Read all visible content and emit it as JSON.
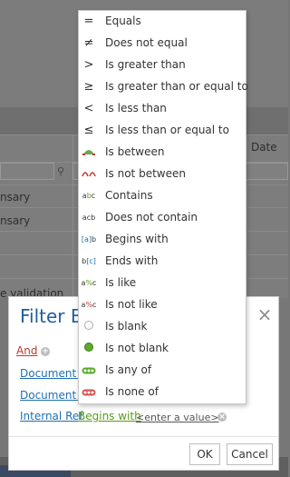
{
  "background": {
    "date_header": "Date",
    "rows": [
      "nsary",
      "nsary",
      "e validation"
    ]
  },
  "operator_menu": {
    "items": [
      {
        "label": "Equals",
        "icon": "="
      },
      {
        "label": "Does not equal",
        "icon": "≠"
      },
      {
        "label": "Is greater than",
        "icon": ">"
      },
      {
        "label": "Is greater than or equal to",
        "icon": "⩾"
      },
      {
        "label": "Is less than",
        "icon": "<"
      },
      {
        "label": "Is less than or equal to",
        "icon": "⩽"
      },
      {
        "label": "Is between",
        "icon": "between"
      },
      {
        "label": "Is not between",
        "icon": "not-between"
      },
      {
        "label": "Contains",
        "icon": "abc"
      },
      {
        "label": "Does not contain",
        "icon": "acb"
      },
      {
        "label": "Begins with",
        "icon": "[a]b"
      },
      {
        "label": "Ends with",
        "icon": "b[c]"
      },
      {
        "label": "Is like",
        "icon": "a%c"
      },
      {
        "label": "Is not like",
        "icon": "a%c"
      },
      {
        "label": "Is blank",
        "icon": "empty-circle"
      },
      {
        "label": "Is not blank",
        "icon": "filled-circle"
      },
      {
        "label": "Is any of",
        "icon": "green-dots"
      },
      {
        "label": "Is none of",
        "icon": "red-dots"
      }
    ]
  },
  "dialog": {
    "title": "Filter Bu",
    "group_operator": "And",
    "conditions": [
      {
        "field": "Document H"
      },
      {
        "field": "Document C"
      },
      {
        "field": "Internal Ref",
        "operator": "Begins with",
        "value_placeholder": "<enter a value>"
      }
    ],
    "ok_label": "OK",
    "cancel_label": "Cancel"
  },
  "colors": {
    "title": "#1f5e9e",
    "link_blue": "#1f6fb2",
    "link_red": "#c0392b",
    "link_green": "#5a9a1a"
  }
}
